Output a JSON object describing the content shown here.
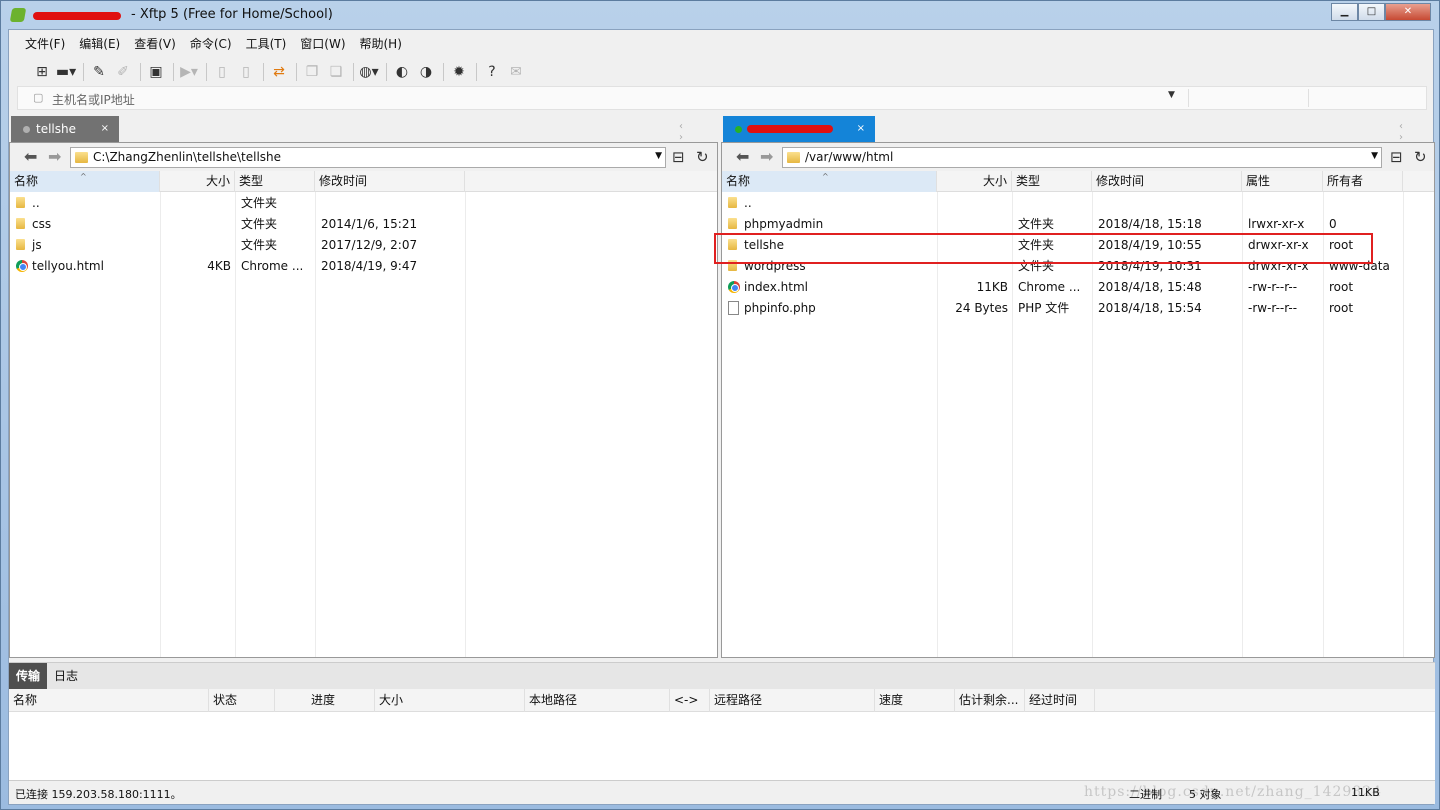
{
  "window": {
    "title": "- Xftp 5 (Free for Home/School)",
    "minimize": "▁",
    "maximize": "□",
    "close": "✕"
  },
  "menu": [
    "文件(F)",
    "编辑(E)",
    "查看(V)",
    "命令(C)",
    "工具(T)",
    "窗口(W)",
    "帮助(H)"
  ],
  "toolbar_icons": [
    "new-session-icon",
    "open-folder-icon",
    "connect-icon",
    "disconnect-icon",
    "session-properties-icon",
    "play-icon",
    "new-file-icon",
    "new-file-2-icon",
    "transfer-icon",
    "copy-icon",
    "paste-icon",
    "globe-icon",
    "xshell-icon",
    "xftp-icon",
    "settings-icon",
    "help-icon",
    "chat-icon"
  ],
  "address": {
    "placeholder": "主机名或IP地址"
  },
  "left_tab": {
    "label": "tellshe",
    "close": "×",
    "dot_color": "#9a9a9a"
  },
  "right_tab": {
    "label": "",
    "close": "×",
    "dot_color": "#1aa31a"
  },
  "tab_nav": "‹ ›",
  "left_pane": {
    "path": "C:\\ZhangZhenlin\\tellshe\\tellshe",
    "columns": {
      "name": "名称",
      "size": "大小",
      "type": "类型",
      "modified": "修改时间"
    },
    "files": [
      {
        "name": "..",
        "icon": "folder",
        "size": "",
        "type": "文件夹",
        "modified": ""
      },
      {
        "name": "css",
        "icon": "folder",
        "size": "",
        "type": "文件夹",
        "modified": "2014/1/6, 15:21"
      },
      {
        "name": "js",
        "icon": "folder",
        "size": "",
        "type": "文件夹",
        "modified": "2017/12/9, 2:07"
      },
      {
        "name": "tellyou.html",
        "icon": "chrome",
        "size": "4KB",
        "type": "Chrome ...",
        "modified": "2018/4/19, 9:47"
      }
    ]
  },
  "right_pane": {
    "path": "/var/www/html",
    "columns": {
      "name": "名称",
      "size": "大小",
      "type": "类型",
      "modified": "修改时间",
      "attr": "属性",
      "owner": "所有者"
    },
    "files": [
      {
        "name": "..",
        "icon": "folder",
        "size": "",
        "type": "",
        "modified": "",
        "attr": "",
        "owner": ""
      },
      {
        "name": "phpmyadmin",
        "icon": "folder",
        "size": "",
        "type": "文件夹",
        "modified": "2018/4/18, 15:18",
        "attr": "lrwxr-xr-x",
        "owner": "0"
      },
      {
        "name": "tellshe",
        "icon": "folder",
        "size": "",
        "type": "文件夹",
        "modified": "2018/4/19, 10:55",
        "attr": "drwxr-xr-x",
        "owner": "root"
      },
      {
        "name": "wordpress",
        "icon": "folder",
        "size": "",
        "type": "文件夹",
        "modified": "2018/4/19, 10:31",
        "attr": "drwxr-xr-x",
        "owner": "www-data"
      },
      {
        "name": "index.html",
        "icon": "chrome",
        "size": "11KB",
        "type": "Chrome ...",
        "modified": "2018/4/18, 15:48",
        "attr": "-rw-r--r--",
        "owner": "root"
      },
      {
        "name": "phpinfo.php",
        "icon": "file",
        "size": "24 Bytes",
        "type": "PHP 文件",
        "modified": "2018/4/18, 15:54",
        "attr": "-rw-r--r--",
        "owner": "root"
      }
    ]
  },
  "bottom": {
    "tabs": [
      "传输",
      "日志"
    ],
    "columns": [
      "名称",
      "状态",
      "进度",
      "大小",
      "本地路径",
      "<->",
      "远程路径",
      "速度",
      "估计剩余...",
      "经过时间"
    ]
  },
  "status": {
    "connection": "已连接 159.203.58.180:1111。",
    "mode": "二进制",
    "objects": "5 对象",
    "size": "11KB"
  },
  "watermark": "https://blog.csdn.net/zhang_1429824"
}
